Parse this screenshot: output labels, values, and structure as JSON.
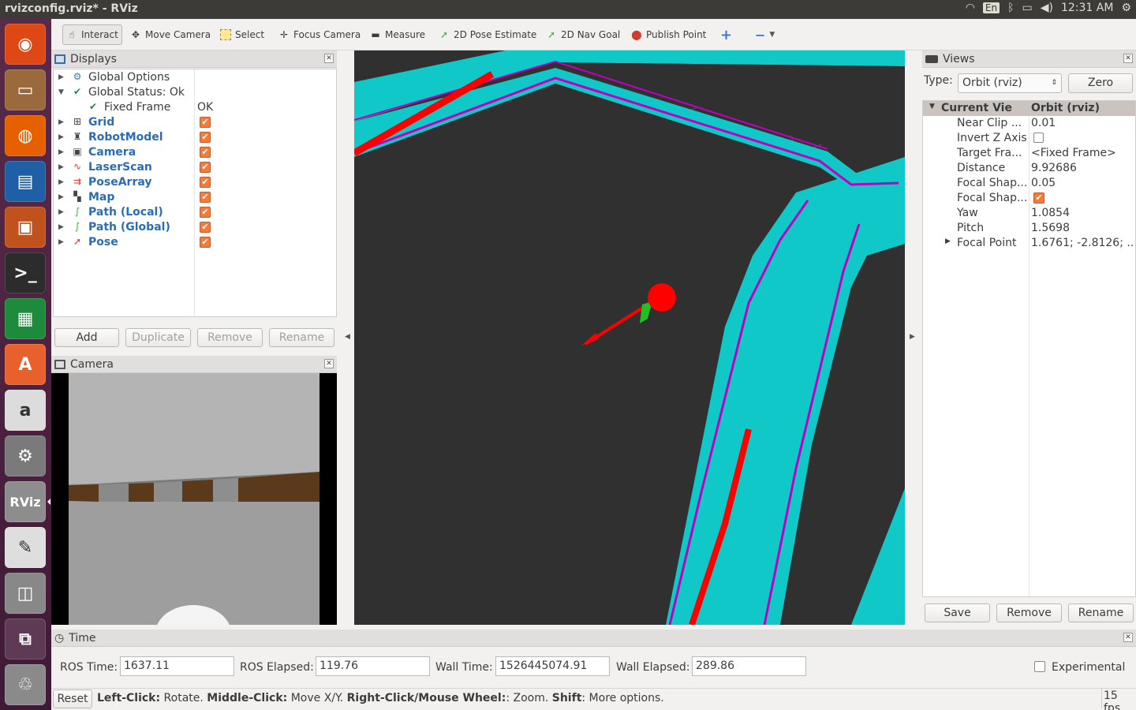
{
  "window": {
    "title": "rvizconfig.rviz* - RViz"
  },
  "tray": {
    "lang": "En",
    "time": "12:31 AM"
  },
  "launcher": [
    {
      "name": "ubuntu",
      "glyph": "◉",
      "color": "#dd4814"
    },
    {
      "name": "files",
      "glyph": "▭",
      "color": "#9b6a3c"
    },
    {
      "name": "firefox",
      "glyph": "◍",
      "color": "#e66000"
    },
    {
      "name": "writer",
      "glyph": "▤",
      "color": "#1e5fa6"
    },
    {
      "name": "impress",
      "glyph": "▣",
      "color": "#c0521e"
    },
    {
      "name": "terminal",
      "glyph": ">_",
      "color": "#2c2c2c"
    },
    {
      "name": "calc",
      "glyph": "▦",
      "color": "#1e8a3c"
    },
    {
      "name": "software",
      "glyph": "A",
      "color": "#e8612c"
    },
    {
      "name": "amazon",
      "glyph": "a",
      "color": "#dcdcdc"
    },
    {
      "name": "settings",
      "glyph": "⚙",
      "color": "#7a7a7a"
    },
    {
      "name": "rviz",
      "glyph": "RViz",
      "color": "#8d8d8d"
    },
    {
      "name": "editor",
      "glyph": "✎",
      "color": "#dedede"
    },
    {
      "name": "screenshot",
      "glyph": "◫",
      "color": "#888"
    },
    {
      "name": "workspaces",
      "glyph": "⧉",
      "color": "#5e3a54"
    },
    {
      "name": "trash",
      "glyph": "♲",
      "color": "#8a8a8a"
    }
  ],
  "toolbar": {
    "interact": "Interact",
    "move_camera": "Move Camera",
    "select": "Select",
    "focus_camera": "Focus Camera",
    "measure": "Measure",
    "pose_estimate": "2D Pose Estimate",
    "nav_goal": "2D Nav Goal",
    "publish_point": "Publish Point"
  },
  "displays": {
    "title": "Displays",
    "items": [
      {
        "label": "Global Options",
        "value": "",
        "bold": false,
        "check": false
      },
      {
        "label": "Global Status: Ok",
        "value": "",
        "bold": false,
        "check": false
      },
      {
        "label": "Fixed Frame",
        "value": "OK",
        "bold": false,
        "check": false
      },
      {
        "label": "Grid",
        "value": "",
        "bold": true,
        "check": true
      },
      {
        "label": "RobotModel",
        "value": "",
        "bold": true,
        "check": true
      },
      {
        "label": "Camera",
        "value": "",
        "bold": true,
        "check": true
      },
      {
        "label": "LaserScan",
        "value": "",
        "bold": true,
        "check": true
      },
      {
        "label": "PoseArray",
        "value": "",
        "bold": true,
        "check": true
      },
      {
        "label": "Map",
        "value": "",
        "bold": true,
        "check": true
      },
      {
        "label": "Path (Local)",
        "value": "",
        "bold": true,
        "check": true
      },
      {
        "label": "Path (Global)",
        "value": "",
        "bold": true,
        "check": true
      },
      {
        "label": "Pose",
        "value": "",
        "bold": true,
        "check": true
      }
    ],
    "buttons": {
      "add": "Add",
      "duplicate": "Duplicate",
      "remove": "Remove",
      "rename": "Rename"
    }
  },
  "camera": {
    "title": "Camera"
  },
  "views": {
    "title": "Views",
    "type_label": "Type:",
    "type_value": "Orbit (rviz)",
    "zero": "Zero",
    "header": {
      "label": "Current View",
      "value": "Orbit (rviz)"
    },
    "rows": [
      {
        "label": "Near Clip ...",
        "value": "0.01"
      },
      {
        "label": "Invert Z Axis",
        "value": ""
      },
      {
        "label": "Target Fra...",
        "value": "<Fixed Frame>"
      },
      {
        "label": "Distance",
        "value": "9.92686"
      },
      {
        "label": "Focal Shap...",
        "value": "0.05"
      },
      {
        "label": "Focal Shap...",
        "value": ""
      },
      {
        "label": "Yaw",
        "value": "1.0854"
      },
      {
        "label": "Pitch",
        "value": "1.5698"
      },
      {
        "label": "Focal Point",
        "value": "1.6761; -2.8126; ..."
      }
    ],
    "buttons": {
      "save": "Save",
      "remove": "Remove",
      "rename": "Rename"
    }
  },
  "time": {
    "title": "Time",
    "ros_time_label": "ROS Time:",
    "ros_time": "1637.11",
    "ros_elapsed_label": "ROS Elapsed:",
    "ros_elapsed": "119.76",
    "wall_time_label": "Wall Time:",
    "wall_time": "1526445074.91",
    "wall_elapsed_label": "Wall Elapsed:",
    "wall_elapsed": "289.86",
    "experimental": "Experimental"
  },
  "status": {
    "reset": "Reset",
    "k1": "Left-Click:",
    "v1": " Rotate. ",
    "k2": "Middle-Click:",
    "v2": " Move X/Y. ",
    "k3": "Right-Click/Mouse Wheel:",
    "v3": ": Zoom. ",
    "k4": "Shift",
    "v4": ": More options.",
    "fps": "15 fps"
  },
  "colors": {
    "map_free": "#303030",
    "map_inflation": "#10c8c8",
    "laser": "#ff0000",
    "costmap_edge": "#c000c0",
    "grid": "#5a5a5a"
  }
}
